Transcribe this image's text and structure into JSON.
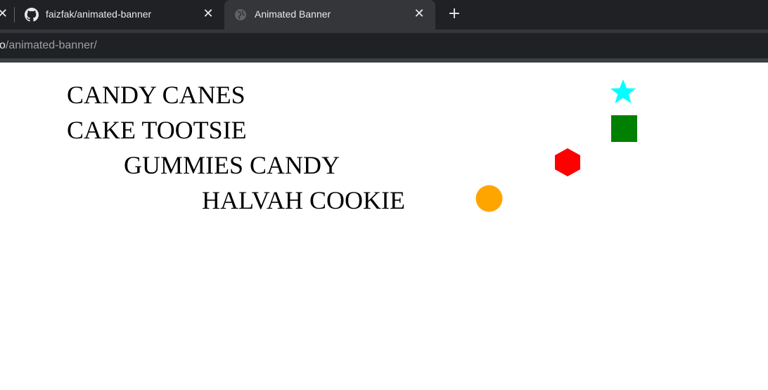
{
  "browser": {
    "tabs": [
      {
        "title": "faizfak/animated-banner",
        "icon": "github-icon",
        "active": false
      },
      {
        "title": "Animated Banner",
        "icon": "globe-icon",
        "active": true
      }
    ],
    "address": {
      "host_fragment": "o",
      "path": "/animated-banner/"
    }
  },
  "banner": {
    "lines": [
      {
        "text": "CANDY CANES",
        "shape": "star",
        "color": "#00ffff"
      },
      {
        "text": "CAKE TOOTSIE",
        "shape": "square",
        "color": "#008000"
      },
      {
        "text": "GUMMIES CANDY",
        "shape": "hexagon",
        "color": "#ff0000"
      },
      {
        "text": "HALVAH COOKIE",
        "shape": "circle",
        "color": "#ffa500"
      }
    ]
  },
  "colors": {
    "chrome_bg": "#202124",
    "active_tab_bg": "#35363a",
    "text_light": "#e8eaed"
  }
}
